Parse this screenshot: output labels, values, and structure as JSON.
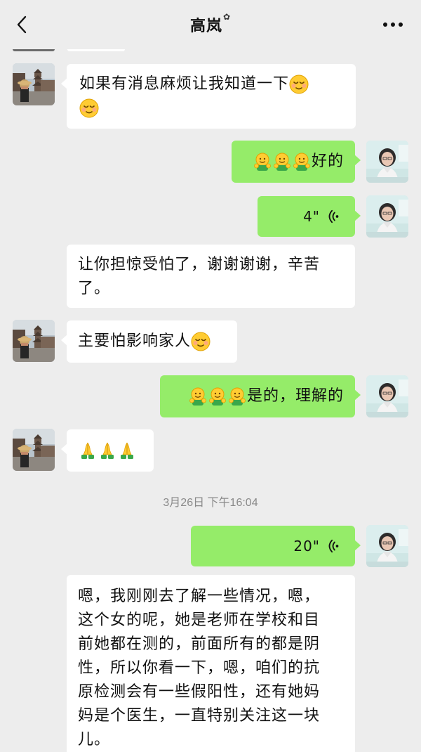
{
  "header": {
    "title": "高岚",
    "title_decoration": "✿",
    "back_icon": "chevron-left-icon",
    "more_icon": "more-horizontal-icon"
  },
  "messages": [
    {
      "side": "left",
      "type": "text",
      "text": "如果有消息麻烦让我知道一下",
      "emoji": [
        "relieved-face",
        "relieved-face"
      ]
    },
    {
      "side": "right",
      "type": "text",
      "text": "好的",
      "emoji_prefix": [
        "hug-emoji",
        "hug-emoji",
        "hug-emoji"
      ]
    },
    {
      "side": "right",
      "type": "voice",
      "duration": "4\"",
      "icon": "voice-wave-icon"
    },
    {
      "side": "left",
      "type": "text",
      "text_line1": "让你担惊受怕了，谢谢谢谢，辛苦",
      "text_line2": "了。"
    },
    {
      "side": "left",
      "type": "text",
      "text": "主要怕影响家人",
      "emoji": [
        "relieved-face"
      ]
    },
    {
      "side": "right",
      "type": "text",
      "text": "是的，理解的",
      "emoji_prefix": [
        "hug-emoji",
        "hug-emoji",
        "hug-emoji"
      ]
    },
    {
      "side": "left",
      "type": "emoji",
      "emoji": [
        "folded-hands-emoji",
        "folded-hands-emoji",
        "folded-hands-emoji"
      ]
    },
    {
      "side": "right",
      "type": "voice",
      "duration": "20\"",
      "icon": "voice-wave-icon"
    },
    {
      "side": "left",
      "type": "text",
      "lines": [
        "嗯，我刚刚去了解一些情况，嗯，",
        "这个女的呢，她是老师在学校和目",
        "前她都在测的，前面所有的都是阴",
        "性，所以你看一下，嗯，咱们的抗",
        "原检测会有一些假阳性，还有她妈",
        "妈是个医生，一直特别关注这一块",
        "儿。"
      ]
    }
  ],
  "timestamp": "3月26日 下午16:04",
  "colors": {
    "background": "#ededed",
    "green_bubble": "#95ec69",
    "white_bubble": "#ffffff",
    "timestamp": "#8a8a8a"
  }
}
